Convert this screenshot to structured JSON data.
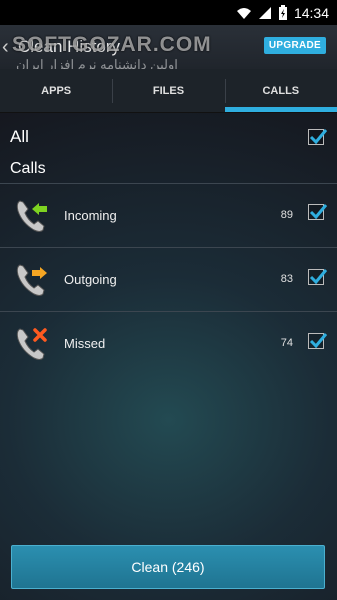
{
  "status_bar": {
    "time": "14:34"
  },
  "header": {
    "title": "Clean History",
    "upgrade_label": "UPGRADE"
  },
  "watermark": {
    "text": "SOFTGOZAR.COM",
    "subtext": "اولین دانشنامه نرم افزار ایران"
  },
  "tabs": [
    {
      "label": "APPS",
      "active": false
    },
    {
      "label": "FILES",
      "active": false
    },
    {
      "label": "CALLS",
      "active": true
    }
  ],
  "select_all": {
    "label": "All",
    "checked": true
  },
  "section": {
    "label": "Calls"
  },
  "items": [
    {
      "label": "Incoming",
      "count": "89",
      "checked": true,
      "icon": "incoming-call-icon"
    },
    {
      "label": "Outgoing",
      "count": "83",
      "checked": true,
      "icon": "outgoing-call-icon"
    },
    {
      "label": "Missed",
      "count": "74",
      "checked": true,
      "icon": "missed-call-icon"
    }
  ],
  "clean_button": {
    "label": "Clean (246)"
  },
  "colors": {
    "accent": "#2faedf",
    "incoming_arrow": "#7ed321",
    "outgoing_arrow": "#f5a623",
    "missed_x": "#ff5a1f"
  }
}
